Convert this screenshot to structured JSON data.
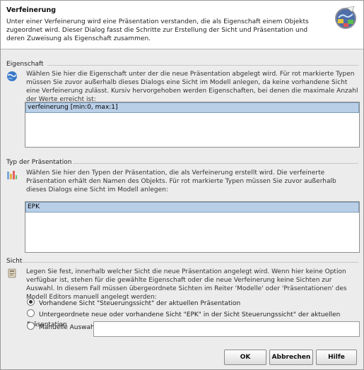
{
  "header": {
    "title": "Verfeinerung",
    "description": "Unter einer Verfeinerung wird eine Präsentation verstanden, die als Eigenschaft einem Objekts zugeordnet wird. Dieser Dialog fasst die Schritte zur Erstellung der Sicht und Präsentation und deren Zuweisung als Eigenschaft zusammen."
  },
  "eigenschaft": {
    "label": "Eigenschaft",
    "text": "Wählen Sie hier die Eigenschaft unter der die neue Präsentation abgelegt wird. Für rot markierte Typen müssen Sie zuvor außerhalb dieses Dialogs eine Sicht im Modell anlegen, da keine vorhandene Sicht eine Verfeinerung zulässt. Kursiv hervorgehoben werden Eigenschaften, bei denen die maximale Anzahl der Werte erreicht ist:",
    "items": [
      "verfeinerung [min:0, max:1]"
    ]
  },
  "typ": {
    "label": "Typ der Präsentation",
    "text": "Wählen Sie hier den Typen der Präsentation, die als Verfeinerung erstellt wird. Die verfeinerte Präsentation erhält den Namen des Objekts. Für rot markierte Typen müssen Sie zuvor außerhalb dieses Dialogs eine Sicht im Modell anlegen:",
    "items": [
      "EPK"
    ]
  },
  "sicht": {
    "label": "Sicht",
    "text": "Legen Sie fest, innerhalb welcher Sicht die neue Präsentation angelegt wird. Wenn hier keine Option verfügbar ist, stehen für die gewählte Eigenschaft oder die neue Verfeinerung keine Sichten zur Auswahl. In diesem Fall müssen übergeordnete Sichten im Reiter 'Modelle' oder 'Präsentationen' des Modell Editors manuell angelegt werden:",
    "options": [
      "Vorhandene Sicht \"Steuerungssicht\" der aktuellen Präsentation",
      "Untergeordnete neue oder vorhandene Sicht \"EPK\" in der Sicht Steuerungssicht\" der aktuellen Präsentation",
      "Manuelle Auswahl"
    ],
    "selected_index": 0,
    "manual_value": ""
  },
  "buttons": {
    "ok": "OK",
    "cancel": "Abbrechen",
    "help": "Hilfe"
  },
  "icons": {
    "header": "wizard-globe-icon",
    "eigenschaft": "globe-icon",
    "typ": "presentation-type-icon",
    "sicht": "view-icon"
  }
}
